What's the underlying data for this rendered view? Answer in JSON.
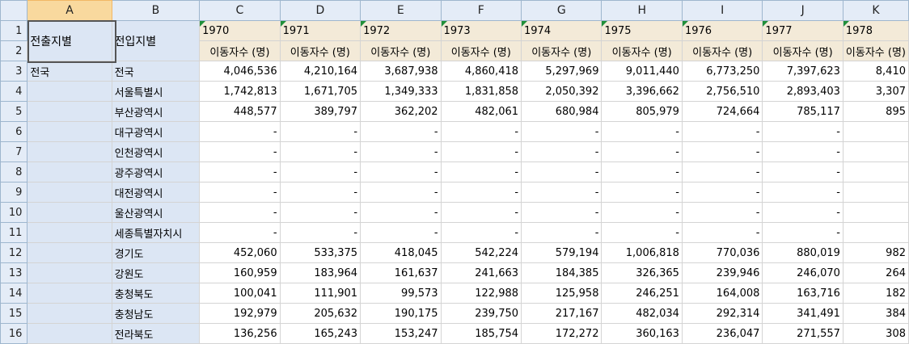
{
  "columns": [
    "A",
    "B",
    "C",
    "D",
    "E",
    "F",
    "G",
    "H",
    "I",
    "J",
    "K"
  ],
  "rows": [
    "1",
    "2",
    "3",
    "4",
    "5",
    "6",
    "7",
    "8",
    "9",
    "10",
    "11",
    "12",
    "13",
    "14",
    "15",
    "16"
  ],
  "header_a": "전출지별",
  "header_b": "전입지별",
  "years": [
    "1970",
    "1971",
    "1972",
    "1973",
    "1974",
    "1975",
    "1976",
    "1977",
    "1978"
  ],
  "unit": "이동자수 (명)",
  "origin": "전국",
  "regions": [
    "전국",
    "서울특별시",
    "부산광역시",
    "대구광역시",
    "인천광역시",
    "광주광역시",
    "대전광역시",
    "울산광역시",
    "세종특별자치시",
    "경기도",
    "강원도",
    "충청북도",
    "충청남도",
    "전라북도"
  ],
  "values": [
    [
      "4,046,536",
      "4,210,164",
      "3,687,938",
      "4,860,418",
      "5,297,969",
      "9,011,440",
      "6,773,250",
      "7,397,623",
      "8,410"
    ],
    [
      "1,742,813",
      "1,671,705",
      "1,349,333",
      "1,831,858",
      "2,050,392",
      "3,396,662",
      "2,756,510",
      "2,893,403",
      "3,307"
    ],
    [
      "448,577",
      "389,797",
      "362,202",
      "482,061",
      "680,984",
      "805,979",
      "724,664",
      "785,117",
      "895"
    ],
    [
      "-",
      "-",
      "-",
      "-",
      "-",
      "-",
      "-",
      "-",
      ""
    ],
    [
      "-",
      "-",
      "-",
      "-",
      "-",
      "-",
      "-",
      "-",
      ""
    ],
    [
      "-",
      "-",
      "-",
      "-",
      "-",
      "-",
      "-",
      "-",
      ""
    ],
    [
      "-",
      "-",
      "-",
      "-",
      "-",
      "-",
      "-",
      "-",
      ""
    ],
    [
      "-",
      "-",
      "-",
      "-",
      "-",
      "-",
      "-",
      "-",
      ""
    ],
    [
      "-",
      "-",
      "-",
      "-",
      "-",
      "-",
      "-",
      "-",
      ""
    ],
    [
      "452,060",
      "533,375",
      "418,045",
      "542,224",
      "579,194",
      "1,006,818",
      "770,036",
      "880,019",
      "982"
    ],
    [
      "160,959",
      "183,964",
      "161,637",
      "241,663",
      "184,385",
      "326,365",
      "239,946",
      "246,070",
      "264"
    ],
    [
      "100,041",
      "111,901",
      "99,573",
      "122,988",
      "125,958",
      "246,251",
      "164,008",
      "163,716",
      "182"
    ],
    [
      "192,979",
      "205,632",
      "190,175",
      "239,750",
      "217,167",
      "482,034",
      "292,314",
      "341,491",
      "384"
    ],
    [
      "136,256",
      "165,243",
      "153,247",
      "185,754",
      "172,272",
      "360,163",
      "236,047",
      "271,557",
      "308"
    ]
  ]
}
